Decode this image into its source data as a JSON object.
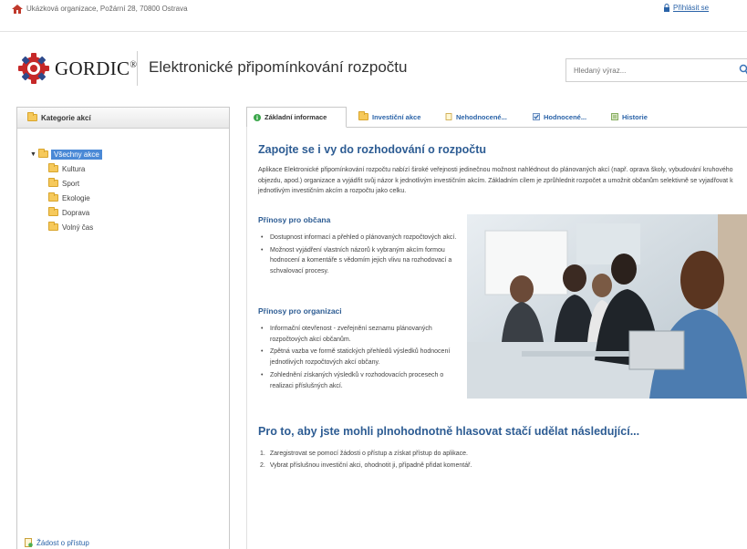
{
  "topbar": {
    "org_address": "Ukázková organizace, Požární 28, 70800 Ostrava",
    "login_label": "Přihlásit se"
  },
  "header": {
    "logo_text": "GORDIC",
    "logo_mark": "®",
    "app_title": "Elektronické připomínkování rozpočtu",
    "search_placeholder": "Hledaný výraz..."
  },
  "sidebar": {
    "title": "Kategorie akcí",
    "root": "Všechny akce",
    "items": [
      "Kultura",
      "Sport",
      "Ekologie",
      "Doprava",
      "Volný čas"
    ],
    "footer_link": "Žádost o přístup"
  },
  "tabs": [
    {
      "label": "Základní informace",
      "active": true,
      "icon": "info-icon"
    },
    {
      "label": "Investiční akce",
      "active": false,
      "icon": "folder-icon"
    },
    {
      "label": "Nehodnocené...",
      "active": false,
      "icon": "document-icon"
    },
    {
      "label": "Hodnocené...",
      "active": false,
      "icon": "checkbox-icon"
    },
    {
      "label": "Historie",
      "active": false,
      "icon": "history-icon"
    }
  ],
  "content": {
    "heading": "Zapojte se i vy do rozhodování o rozpočtu",
    "intro": "Aplikace Elektronické připomínkování rozpočtu nabízí široké veřejnosti jedinečnou možnost nahlédnout do plánovaných akcí (např. oprava školy, vybudování kruhového objezdu, apod.) organizace a vyjádřit svůj názor k jednotlivým investičním akcím. Základním cílem je zprůhlednit rozpočet a umožnit občanům selektivně se vyjadřovat k jednotlivým investičním akcím a rozpočtu jako celku.",
    "citizens_heading": "Přínosy pro občana",
    "citizens": [
      "Dostupnost informací a přehled o plánovaných rozpočtových akcí.",
      "Možnost vyjádření vlastních názorů k vybraným akcím formou hodnocení a komentáře s vědomím jejich vlivu na rozhodovací a schvalovací procesy."
    ],
    "org_heading": "Přínosy pro organizaci",
    "organization": [
      "Informační otevřenost - zveřejnění seznamu plánovaných rozpočtových akcí občanům.",
      "Zpětná vazba ve formě statických přehledů výsledků hodnocení jednotlivých rozpočtových akcí občany.",
      "Zohlednění získaných výsledků v rozhodovacích procesech o realizaci příslušných akcí."
    ],
    "steps_heading": "Pro to, aby jste mohli plnohodnotně hlasovat stačí udělat následující...",
    "steps": [
      {
        "num": "1.",
        "text": "Zaregistrovat se pomocí žádosti o přístup a získat přístup do aplikace."
      },
      {
        "num": "2.",
        "text": "Vybrat příslušnou investiční akci, ohodnotit ji, případně přidat komentář."
      }
    ]
  },
  "colors": {
    "link": "#2a63a8",
    "heading": "#2d5c93",
    "selected": "#4a89d6"
  }
}
